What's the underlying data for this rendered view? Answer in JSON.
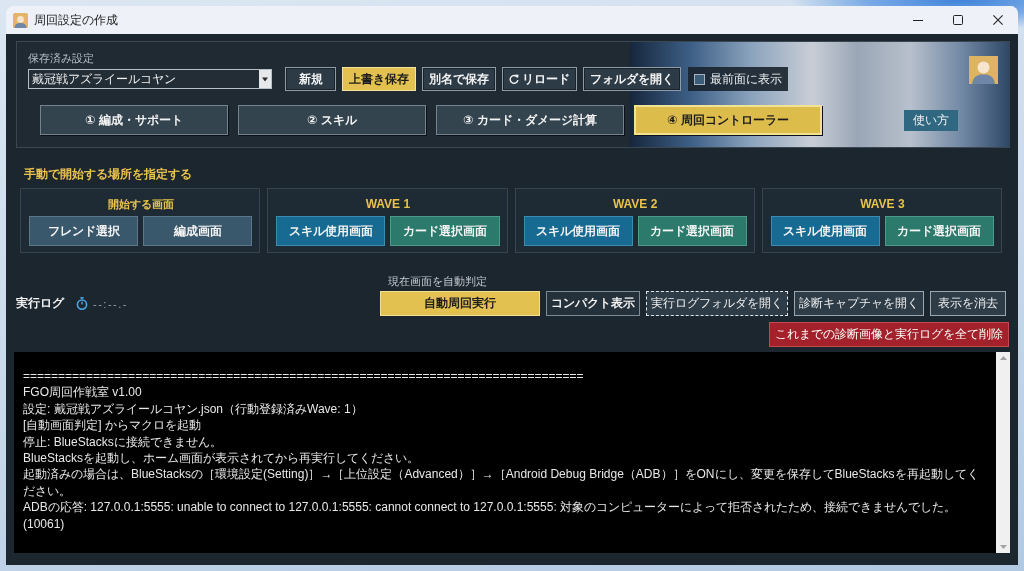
{
  "window": {
    "title": "周回設定の作成"
  },
  "saved_settings": {
    "label": "保存済み設定",
    "value": "戴冠戦アズライールコヤン",
    "buttons": [
      {
        "label": "新規",
        "kind": "plain"
      },
      {
        "label": "上書き保存",
        "kind": "primary"
      },
      {
        "label": "別名で保存",
        "kind": "plain"
      },
      {
        "label": "リロード",
        "kind": "reload"
      },
      {
        "label": "フォルダを開く",
        "kind": "plain"
      }
    ],
    "always_on_top": {
      "label": "最前面に表示",
      "checked": false
    }
  },
  "tabs": [
    {
      "label": "① 編成・サポート",
      "selected": false
    },
    {
      "label": "② スキル",
      "selected": false
    },
    {
      "label": "③ カード・ダメージ計算",
      "selected": false
    },
    {
      "label": "④ 周回コントローラー",
      "selected": true
    }
  ],
  "help_button": {
    "label": "使い方"
  },
  "manual_start": {
    "title": "手動で開始する場所を指定する",
    "groups": [
      {
        "title": "開始する画面",
        "kind": "start",
        "buttons": [
          {
            "label": "フレンド選択",
            "kind": "screen"
          },
          {
            "label": "編成画面",
            "kind": "screen"
          }
        ]
      },
      {
        "title": "WAVE 1",
        "kind": "wave",
        "buttons": [
          {
            "label": "スキル使用画面",
            "kind": "skill"
          },
          {
            "label": "カード選択画面",
            "kind": "card"
          }
        ]
      },
      {
        "title": "WAVE 2",
        "kind": "wave",
        "buttons": [
          {
            "label": "スキル使用画面",
            "kind": "skill"
          },
          {
            "label": "カード選択画面",
            "kind": "card"
          }
        ]
      },
      {
        "title": "WAVE 3",
        "kind": "wave",
        "buttons": [
          {
            "label": "スキル使用画面",
            "kind": "skill"
          },
          {
            "label": "カード選択画面",
            "kind": "card"
          }
        ]
      }
    ]
  },
  "log": {
    "title": "実行ログ",
    "timer": "--:--.-",
    "auto_detect_label": "現在画面を自動判定",
    "buttons": [
      {
        "label": "自動周回実行",
        "kind": "primary",
        "focused": false
      },
      {
        "label": "コンパクト表示",
        "kind": "dark",
        "focused": false
      },
      {
        "label": "実行ログフォルダを開く",
        "kind": "plain",
        "focused": true
      },
      {
        "label": "診断キャプチャを開く",
        "kind": "plain",
        "focused": false
      },
      {
        "label": "表示を消去",
        "kind": "plain",
        "focused": false
      }
    ],
    "delete_button": {
      "label": "これまでの診断画像と実行ログを全て削除"
    },
    "lines": [
      "================================================================================",
      "FGO周回作戦室 v1.00",
      "設定: 戴冠戦アズライールコヤン.json（行動登録済みWave: 1）",
      "[自動画面判定] からマクロを起動",
      "停止: BlueStacksに接続できません。",
      "BlueStacksを起動し、ホーム画面が表示されてから再実行してください。",
      "起動済みの場合は、BlueStacksの［環境設定(Setting)］→［上位設定（Advanced）］→［Android Debug Bridge（ADB）］をONにし、変更を保存してBlueStacksを再起動してください。",
      "ADBの応答: 127.0.0.1:5555: unable to connect to 127.0.0.1:5555: cannot connect to 127.0.0.1:5555: 対象のコンピューターによって拒否されたため、接続できませんでした。(10061)"
    ]
  }
}
